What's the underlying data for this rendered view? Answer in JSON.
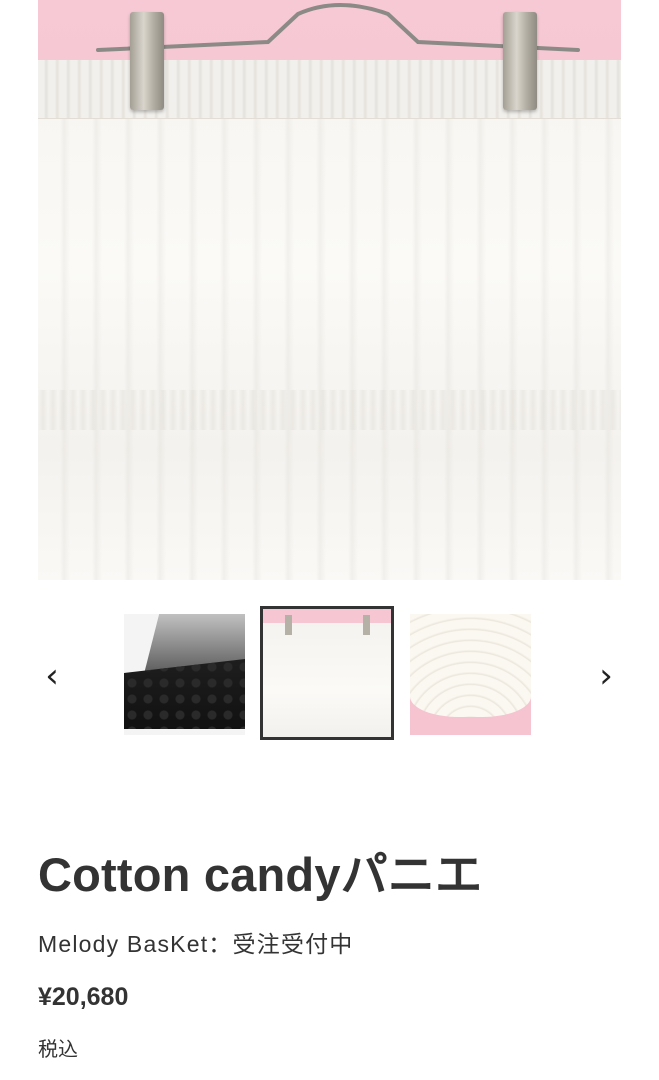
{
  "gallery": {
    "main_image": {
      "alt": "white tulle petticoat on hanger",
      "background_color": "#f5c2cf"
    },
    "prev_arrow": "‹",
    "next_arrow": "›",
    "thumbnails": [
      {
        "label": "black lace petticoat",
        "selected": false
      },
      {
        "label": "white petticoat on hanger",
        "selected": true
      },
      {
        "label": "white frilled petticoat",
        "selected": false
      }
    ]
  },
  "product": {
    "title": "Cotton candyパニエ",
    "vendor": "Melody BasKet：受注受付中",
    "price": "¥20,680",
    "tax_note": "税込"
  },
  "colors": {
    "text": "#333333",
    "pink_backdrop": "#f5c2cf",
    "selected_border": "#333333"
  },
  "icons": {
    "prev": "chevron-left-icon",
    "next": "chevron-right-icon"
  }
}
